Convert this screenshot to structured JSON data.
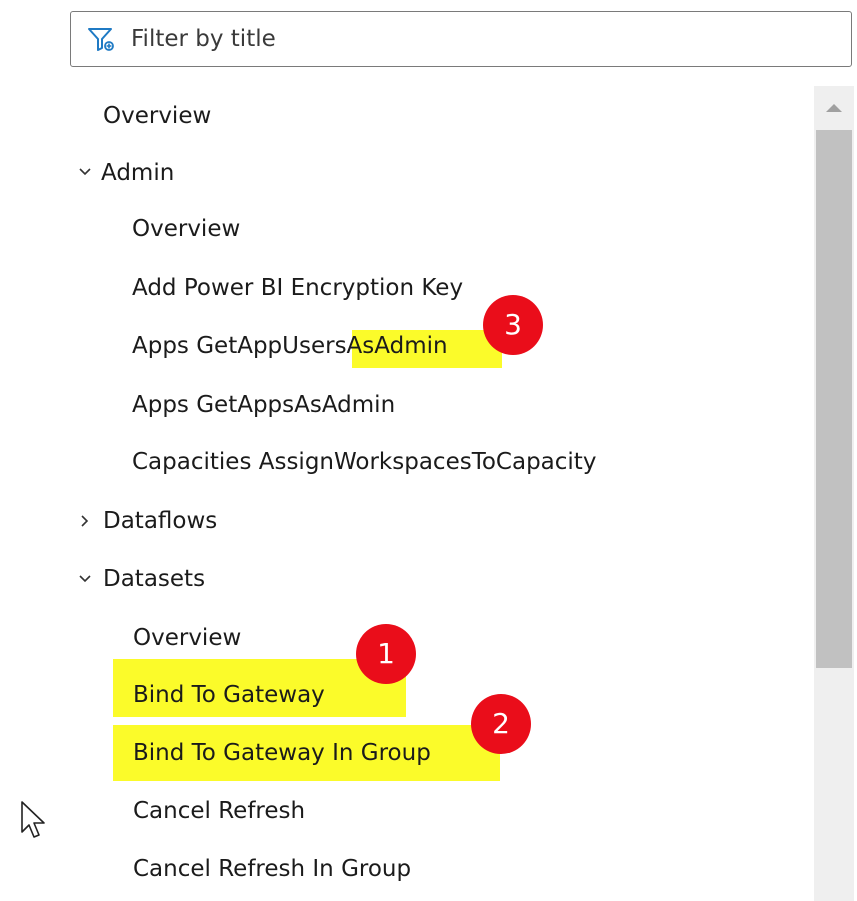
{
  "filter": {
    "placeholder": "Filter by title",
    "value": ""
  },
  "tree": {
    "overview": "Overview",
    "admin": {
      "label": "Admin",
      "expanded": true,
      "items": [
        "Overview",
        "Add Power BI Encryption Key",
        "Apps GetAppUsersAsAdmin",
        "Apps GetAppsAsAdmin",
        "Capacities AssignWorkspacesToCapacity"
      ]
    },
    "dataflows": {
      "label": "Dataflows",
      "expanded": false
    },
    "datasets": {
      "label": "Datasets",
      "expanded": true,
      "items": [
        "Overview",
        "Bind To Gateway",
        "Bind To Gateway In Group",
        "Cancel Refresh",
        "Cancel Refresh In Group"
      ]
    }
  },
  "badges": [
    "1",
    "2",
    "3"
  ],
  "colors": {
    "highlight": "#fbfb2a",
    "badge": "#ea0d1a",
    "scrollbar_track": "#efefef",
    "scrollbar_thumb": "#c1c1c1",
    "filter_icon": "#1f7ac4"
  },
  "icons": {
    "filter": "filter-icon",
    "collapse": "chevron-down-icon",
    "expand": "chevron-right-icon",
    "scroll_up": "triangle-up-icon",
    "cursor": "mouse-pointer-icon"
  }
}
